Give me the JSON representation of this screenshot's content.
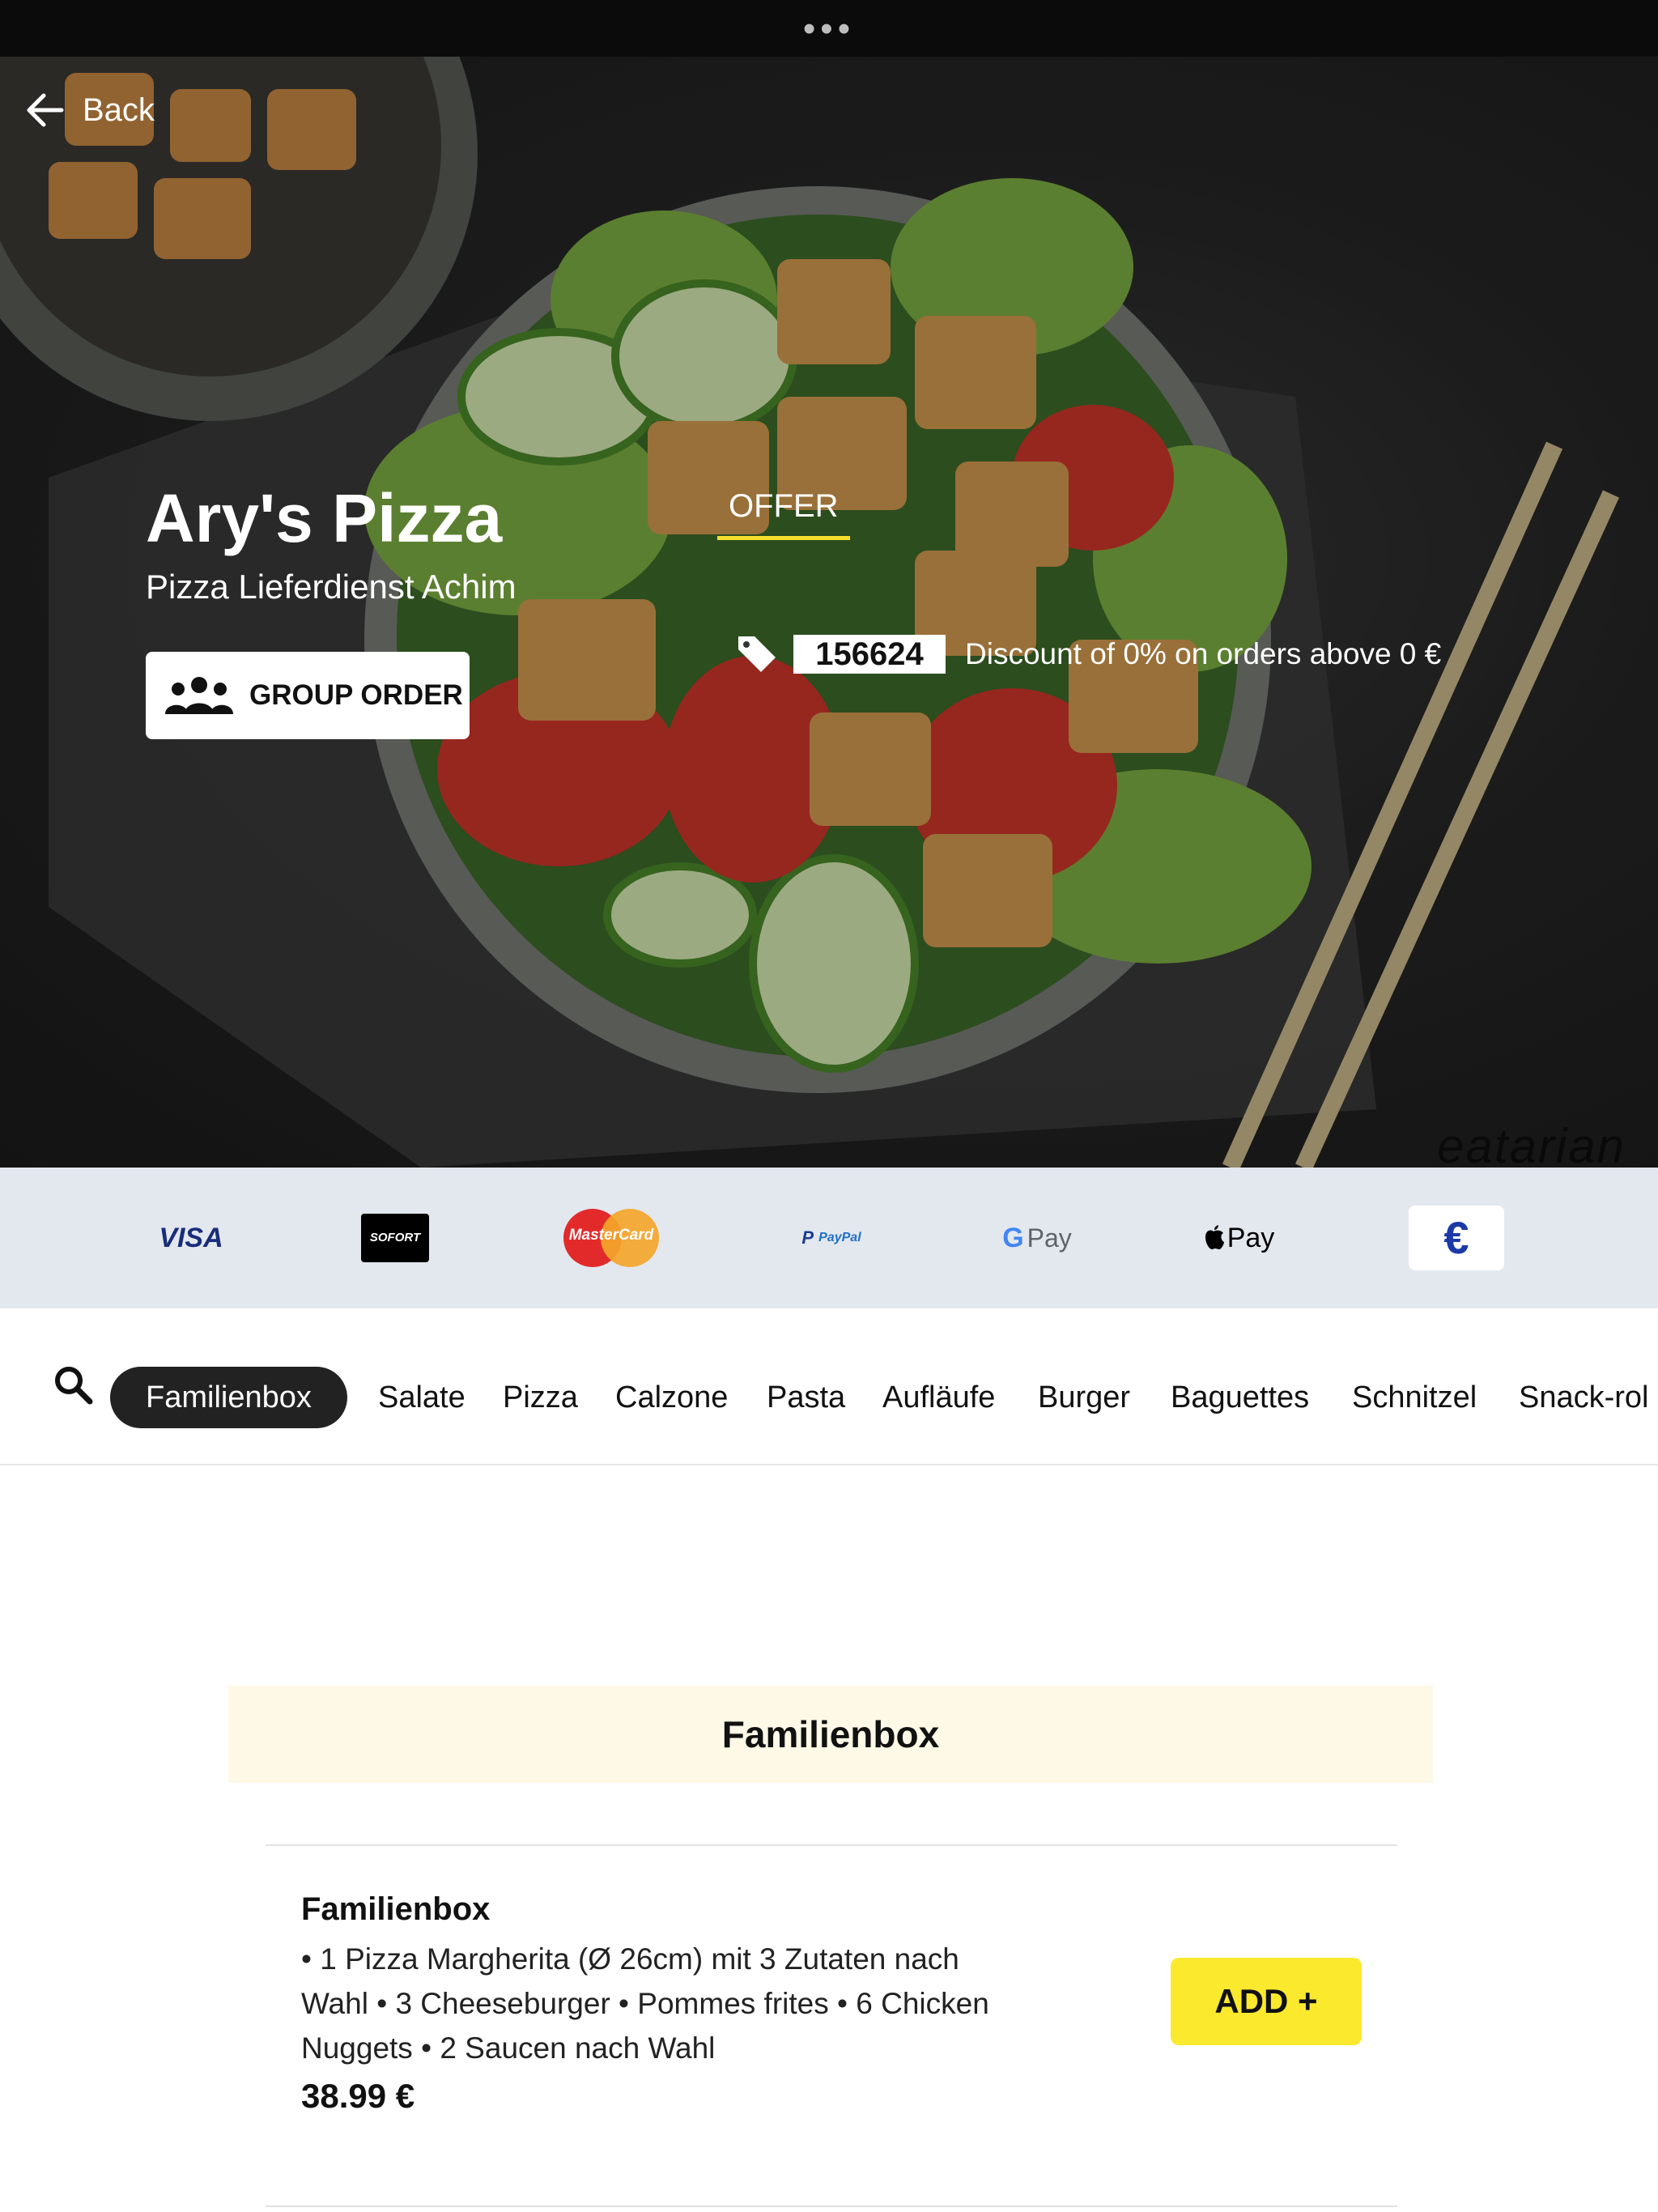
{
  "top": {
    "dots": "•••"
  },
  "nav": {
    "back_label": "Back"
  },
  "restaurant": {
    "name": "Ary's Pizza",
    "subtitle": "Pizza Lieferdienst Achim",
    "group_order_label": "GROUP ORDER"
  },
  "offer": {
    "title": "OFFER",
    "code": "156624",
    "description": "Discount of 0% on orders above 0 €"
  },
  "hero": {
    "watermark": "eatarian"
  },
  "payments": [
    {
      "name": "VISA"
    },
    {
      "name": "SOFORT"
    },
    {
      "name": "MasterCard"
    },
    {
      "name": "PayPal"
    },
    {
      "name": "Pay",
      "prefix": "G"
    },
    {
      "name": "Pay",
      "prefix": ""
    },
    {
      "name": "€"
    }
  ],
  "categories": [
    "Familienbox",
    "Salate",
    "Pizza",
    "Calzone",
    "Pasta",
    "Aufläufe",
    "Burger",
    "Baguettes",
    "Schnitzel",
    "Snack-rol"
  ],
  "active_category": "Familienbox",
  "section": {
    "title": "Familienbox",
    "items": [
      {
        "name": "Familienbox",
        "description": "• 1 Pizza Margherita (Ø 26cm) mit 3 Zutaten nach Wahl • 3 Cheeseburger • Pommes frites • 6 Chicken Nuggets • 2 Saucen nach Wahl",
        "price": "38.99 €",
        "add_label": "ADD +"
      }
    ]
  },
  "colors": {
    "accent_yellow": "#fbe92e",
    "section_bg": "#fdf9e6",
    "paybar_bg": "#e3e8ef"
  }
}
